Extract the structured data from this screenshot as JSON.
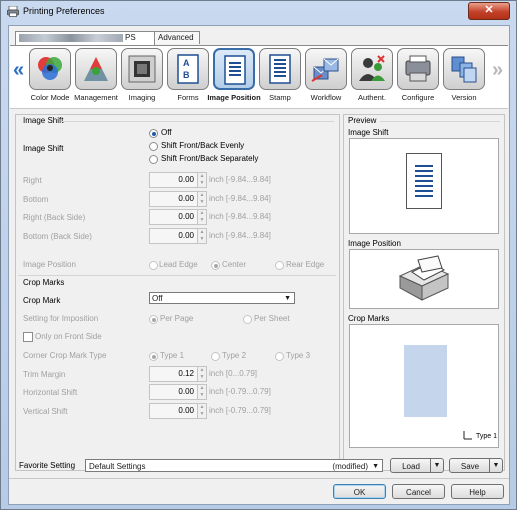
{
  "window": {
    "title": "Printing Preferences",
    "close": "✕"
  },
  "tabs": {
    "printer_suffix": "PS",
    "advanced": "Advanced"
  },
  "iconbar": {
    "left_arrow": "«",
    "right_arrow": "»",
    "items": [
      {
        "label": "Color Mode",
        "icon": "color-mode-icon"
      },
      {
        "label": "Management",
        "icon": "management-icon"
      },
      {
        "label": "Imaging",
        "icon": "imaging-icon"
      },
      {
        "label": "Forms",
        "icon": "forms-icon"
      },
      {
        "label": "Image Position",
        "icon": "image-position-icon",
        "selected": true
      },
      {
        "label": "Stamp",
        "icon": "stamp-icon"
      },
      {
        "label": "Workflow",
        "icon": "workflow-icon"
      },
      {
        "label": "Authent.",
        "icon": "authentication-icon"
      },
      {
        "label": "Configure",
        "icon": "configure-icon"
      },
      {
        "label": "Version",
        "icon": "version-icon"
      }
    ]
  },
  "image_shift": {
    "section": "Image Shift",
    "label": "Image Shift",
    "options": [
      "Off",
      "Shift Front/Back Evenly",
      "Shift Front/Back Separately"
    ],
    "selected": "Off",
    "fields": [
      {
        "label": "Right",
        "value": "0.00",
        "unit": "inch [-9.84...9.84]"
      },
      {
        "label": "Bottom",
        "value": "0.00",
        "unit": "inch [-9.84...9.84]"
      },
      {
        "label": "Right (Back Side)",
        "value": "0.00",
        "unit": "inch [-9.84...9.84]"
      },
      {
        "label": "Bottom (Back Side)",
        "value": "0.00",
        "unit": "inch [-9.84...9.84]"
      }
    ],
    "position_label": "Image Position",
    "position_options": [
      "Lead Edge",
      "Center",
      "Rear Edge"
    ],
    "position_selected": "Center"
  },
  "crop_marks": {
    "section": "Crop Marks",
    "label": "Crop Mark",
    "value": "Off",
    "imposition_label": "Setting for Imposition",
    "imposition_options": [
      "Per Page",
      "Per Sheet"
    ],
    "imposition_selected": "Per Page",
    "front_only": "Only on Front Side",
    "corner_label": "Corner Crop Mark Type",
    "corner_options": [
      "Type 1",
      "Type 2",
      "Type 3"
    ],
    "corner_selected": "Type 1",
    "fields": [
      {
        "label": "Trim Margin",
        "value": "0.12",
        "unit": "inch [0...0.79]"
      },
      {
        "label": "Horizontal Shift",
        "value": "0.00",
        "unit": "inch [-0.79...0.79]"
      },
      {
        "label": "Vertical Shift",
        "value": "0.00",
        "unit": "inch [-0.79...0.79]"
      }
    ]
  },
  "preview": {
    "title": "Preview",
    "image_shift": "Image Shift",
    "image_position": "Image Position",
    "crop_marks": "Crop Marks",
    "type_caption": "Type 1"
  },
  "favorite": {
    "label": "Favorite Setting",
    "value": "Default Settings",
    "modified": "(modified)",
    "load": "Load",
    "save": "Save"
  },
  "buttons": {
    "ok": "OK",
    "cancel": "Cancel",
    "help": "Help"
  },
  "colors": {
    "selected_border": "#3a6da8",
    "crop_fill": "#c5d6ec"
  }
}
